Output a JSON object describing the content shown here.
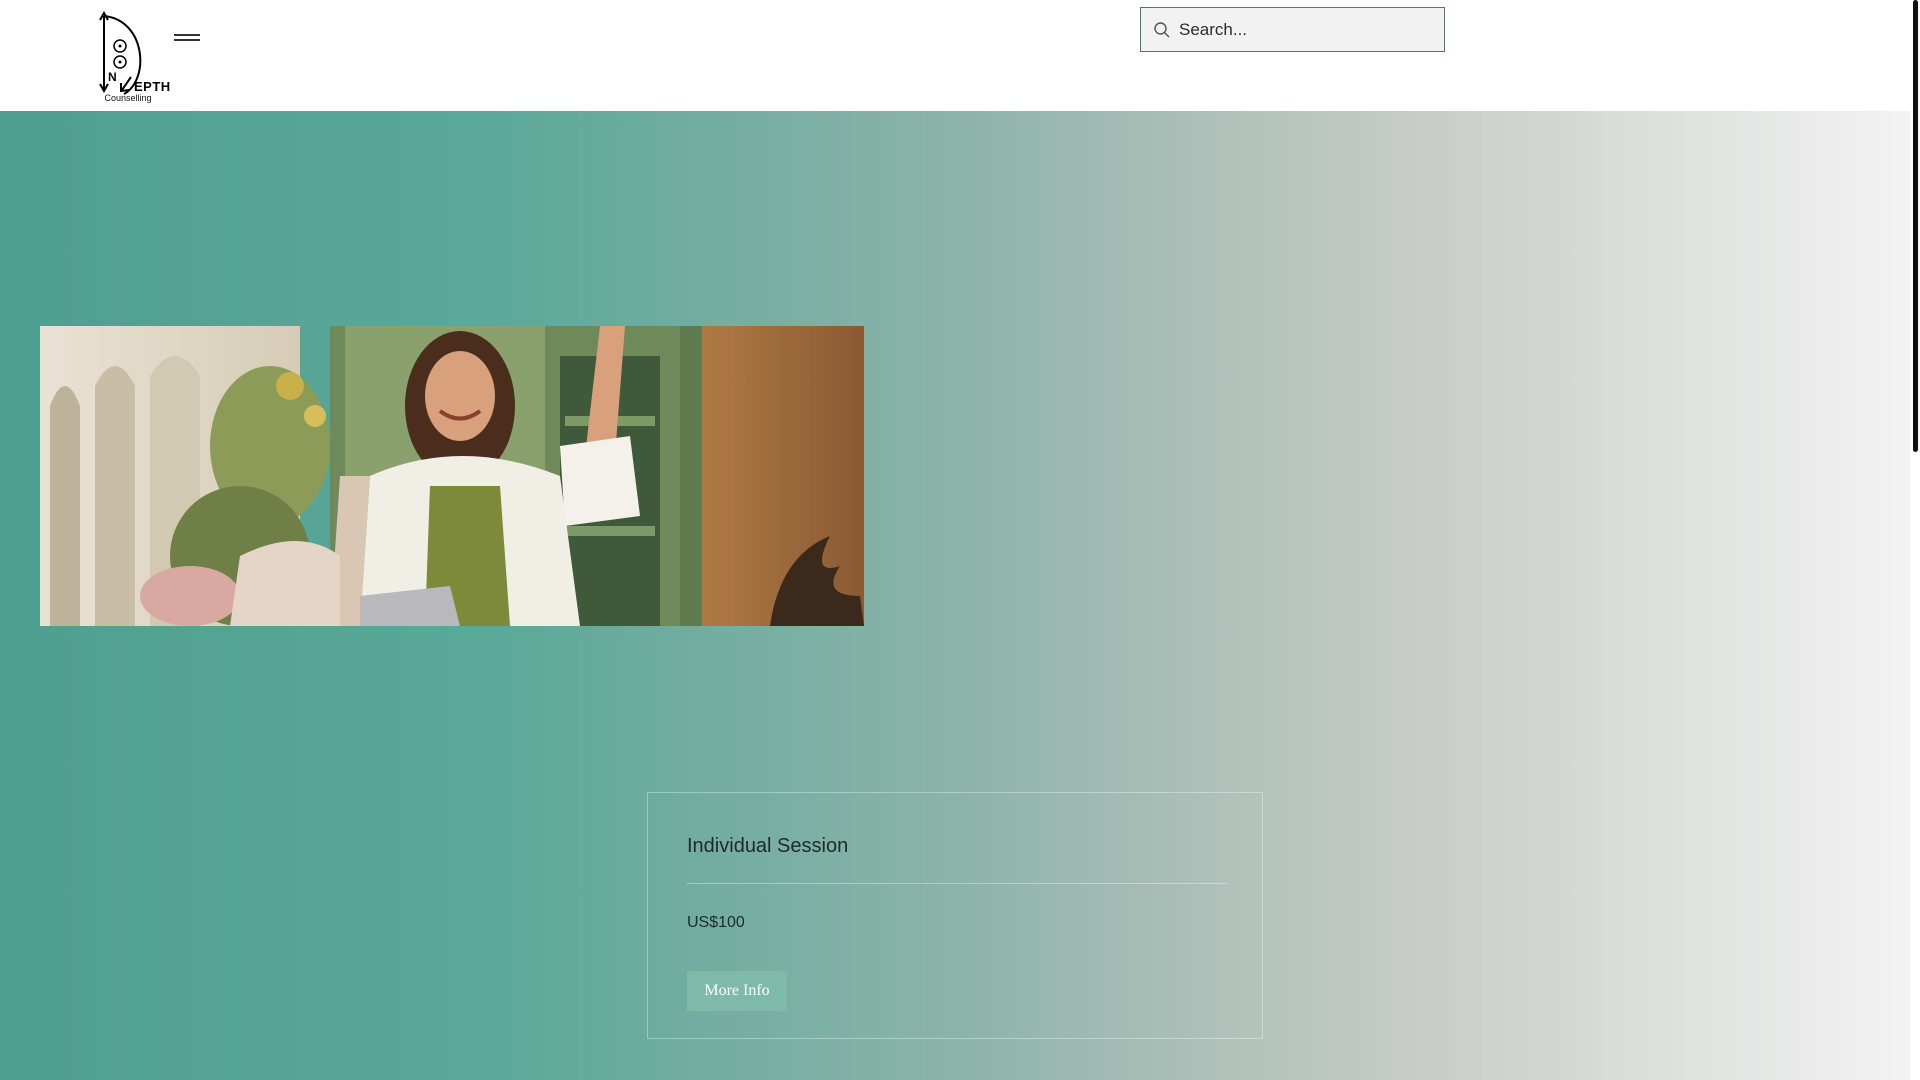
{
  "header": {
    "logo": {
      "letters": "N",
      "word": "EPTH",
      "subtitle": "Counselling"
    },
    "search": {
      "placeholder": "Search...",
      "value": ""
    }
  },
  "hero": {
    "image": {
      "icon": "woman-smiling-photo"
    }
  },
  "card": {
    "title": "Individual Session",
    "price": "US$100",
    "button_label": "More Info"
  },
  "colors": {
    "accent": "#7fbaa8",
    "hero_start": "#4f9f91",
    "hero_end": "#f3f3f3",
    "search_border": "#4a7a72"
  }
}
